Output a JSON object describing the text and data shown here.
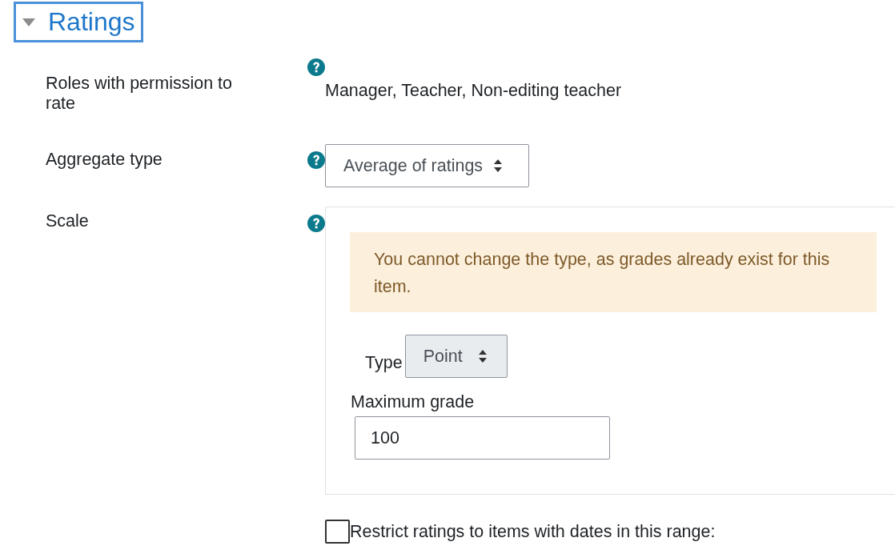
{
  "section": {
    "title": "Ratings",
    "expanded": true
  },
  "fields": [
    {
      "kind": "static",
      "label": "Roles with permission to rate",
      "help": true,
      "value": "Manager, Teacher, Non-editing teacher"
    },
    {
      "kind": "select",
      "label": "Aggregate type",
      "help": true,
      "value": "Average of ratings",
      "disabled": false
    },
    {
      "kind": "group",
      "label": "Scale",
      "help": true,
      "alert": "You cannot change the type, as grades already exist for this item.",
      "type_label": "Type",
      "type_value": "Point",
      "type_disabled": true,
      "max_label": "Maximum grade",
      "max_value": "100"
    },
    {
      "kind": "checkbox",
      "label": "Restrict ratings to items with dates in this range:",
      "checked": false
    }
  ]
}
